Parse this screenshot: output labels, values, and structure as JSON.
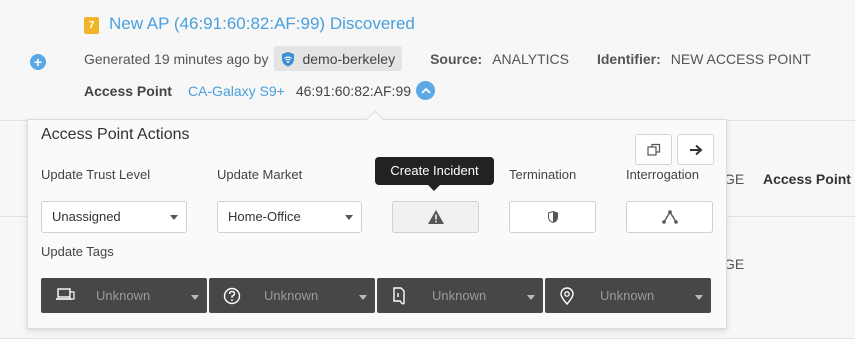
{
  "alert": {
    "badge": "7",
    "title": "New AP (46:91:60:82:AF:99) Discovered",
    "generated": "Generated 19 minutes ago by",
    "user": "demo-berkeley",
    "source_label": "Source:",
    "source_value": "ANALYTICS",
    "identifier_label": "Identifier:",
    "identifier_value": "NEW ACCESS POINT",
    "ap_label": "Access Point",
    "ap_name": "CA-Galaxy S9+",
    "ap_mac": "46:91:60:82:AF:99"
  },
  "background": {
    "ge_1": "GE",
    "access_point": "Access Point",
    "ge_2": "GE"
  },
  "panel": {
    "title": "Access Point Actions",
    "trust_label": "Update Trust Level",
    "trust_value": "Unassigned",
    "market_label": "Update Market",
    "market_value": "Home-Office",
    "incident_tooltip": "Create Incident",
    "termination_label": "Termination",
    "interrogation_label": "Interrogation",
    "tags_label": "Update Tags",
    "tags": [
      {
        "icon": "device-icon",
        "value": "Unknown"
      },
      {
        "icon": "question-icon",
        "value": "Unknown"
      },
      {
        "icon": "document-icon",
        "value": "Unknown"
      },
      {
        "icon": "location-pin-icon",
        "value": "Unknown"
      }
    ]
  },
  "colors": {
    "link": "#4a9fdc",
    "badge": "#f0b429",
    "tag_bg": "#474747"
  }
}
